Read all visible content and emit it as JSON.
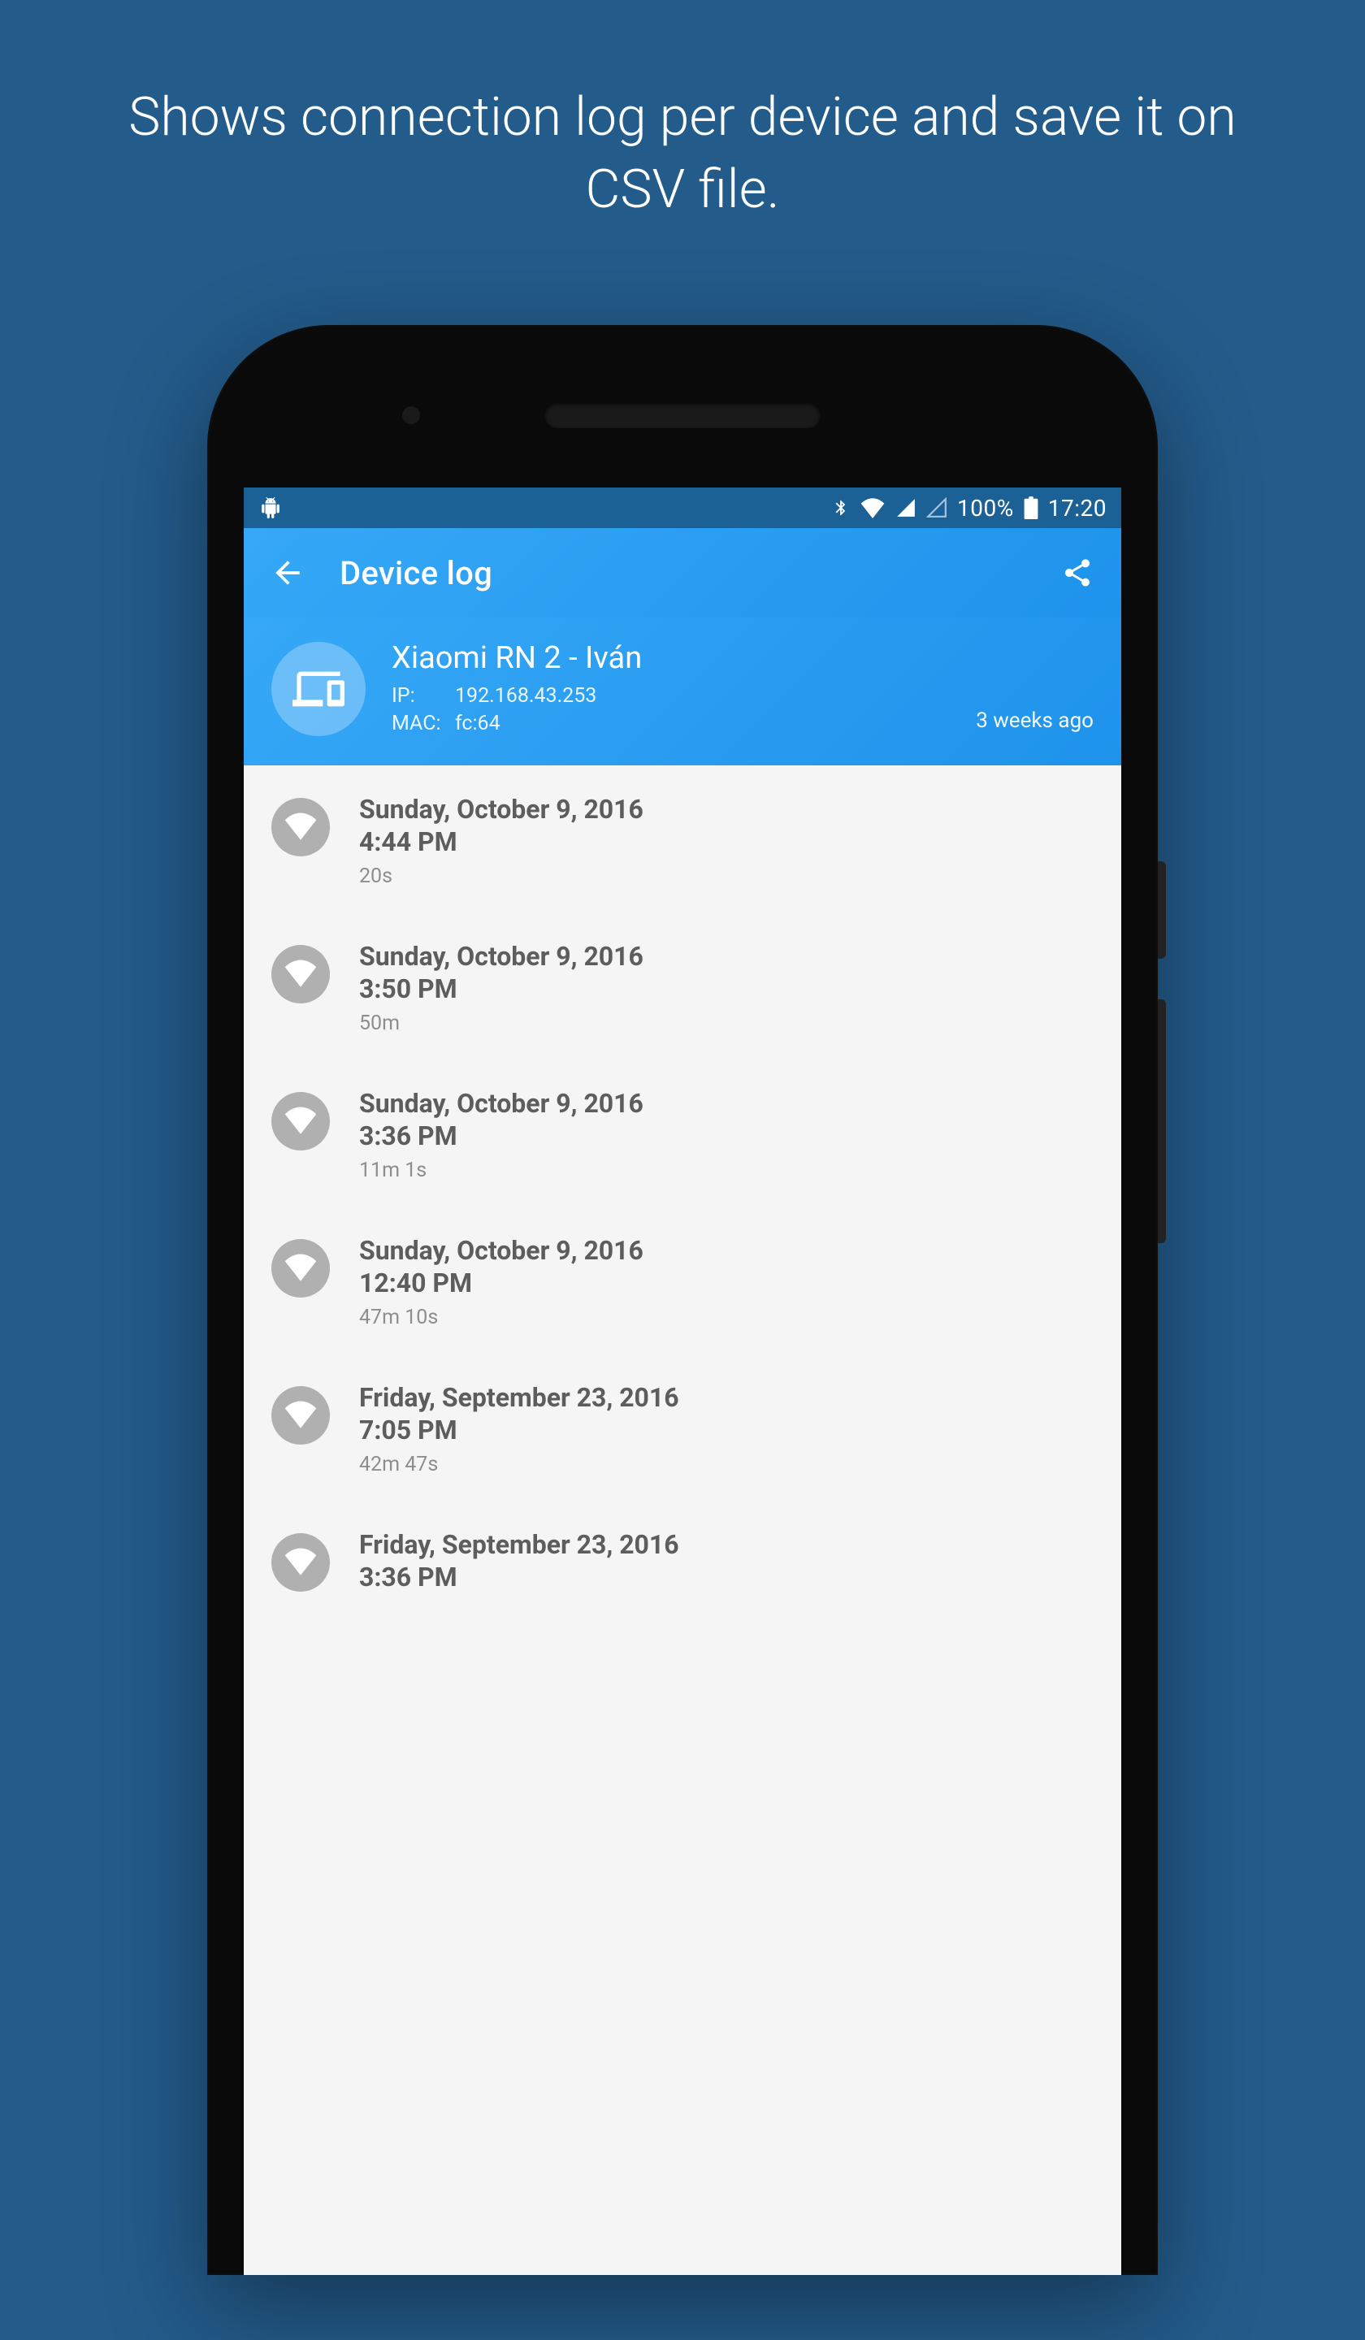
{
  "promo": {
    "caption": "Shows connection log per device and save it on CSV file."
  },
  "status_bar": {
    "battery_pct": "100%",
    "clock": "17:20"
  },
  "app_bar": {
    "title": "Device log"
  },
  "device": {
    "name": "Xiaomi RN 2 - Iván",
    "ip_label": "IP:",
    "ip_value": "192.168.43.253",
    "mac_label": "MAC:",
    "mac_value": "fc:64",
    "timestamp": "3 weeks ago"
  },
  "log_entries": [
    {
      "date": "Sunday, October 9, 2016",
      "time": "4:44 PM",
      "duration": "20s"
    },
    {
      "date": "Sunday, October 9, 2016",
      "time": "3:50 PM",
      "duration": "50m"
    },
    {
      "date": "Sunday, October 9, 2016",
      "time": "3:36 PM",
      "duration": "11m 1s"
    },
    {
      "date": "Sunday, October 9, 2016",
      "time": "12:40 PM",
      "duration": "47m 10s"
    },
    {
      "date": "Friday, September 23, 2016",
      "time": "7:05 PM",
      "duration": "42m 47s"
    },
    {
      "date": "Friday, September 23, 2016",
      "time": "3:36 PM",
      "duration": ""
    }
  ]
}
